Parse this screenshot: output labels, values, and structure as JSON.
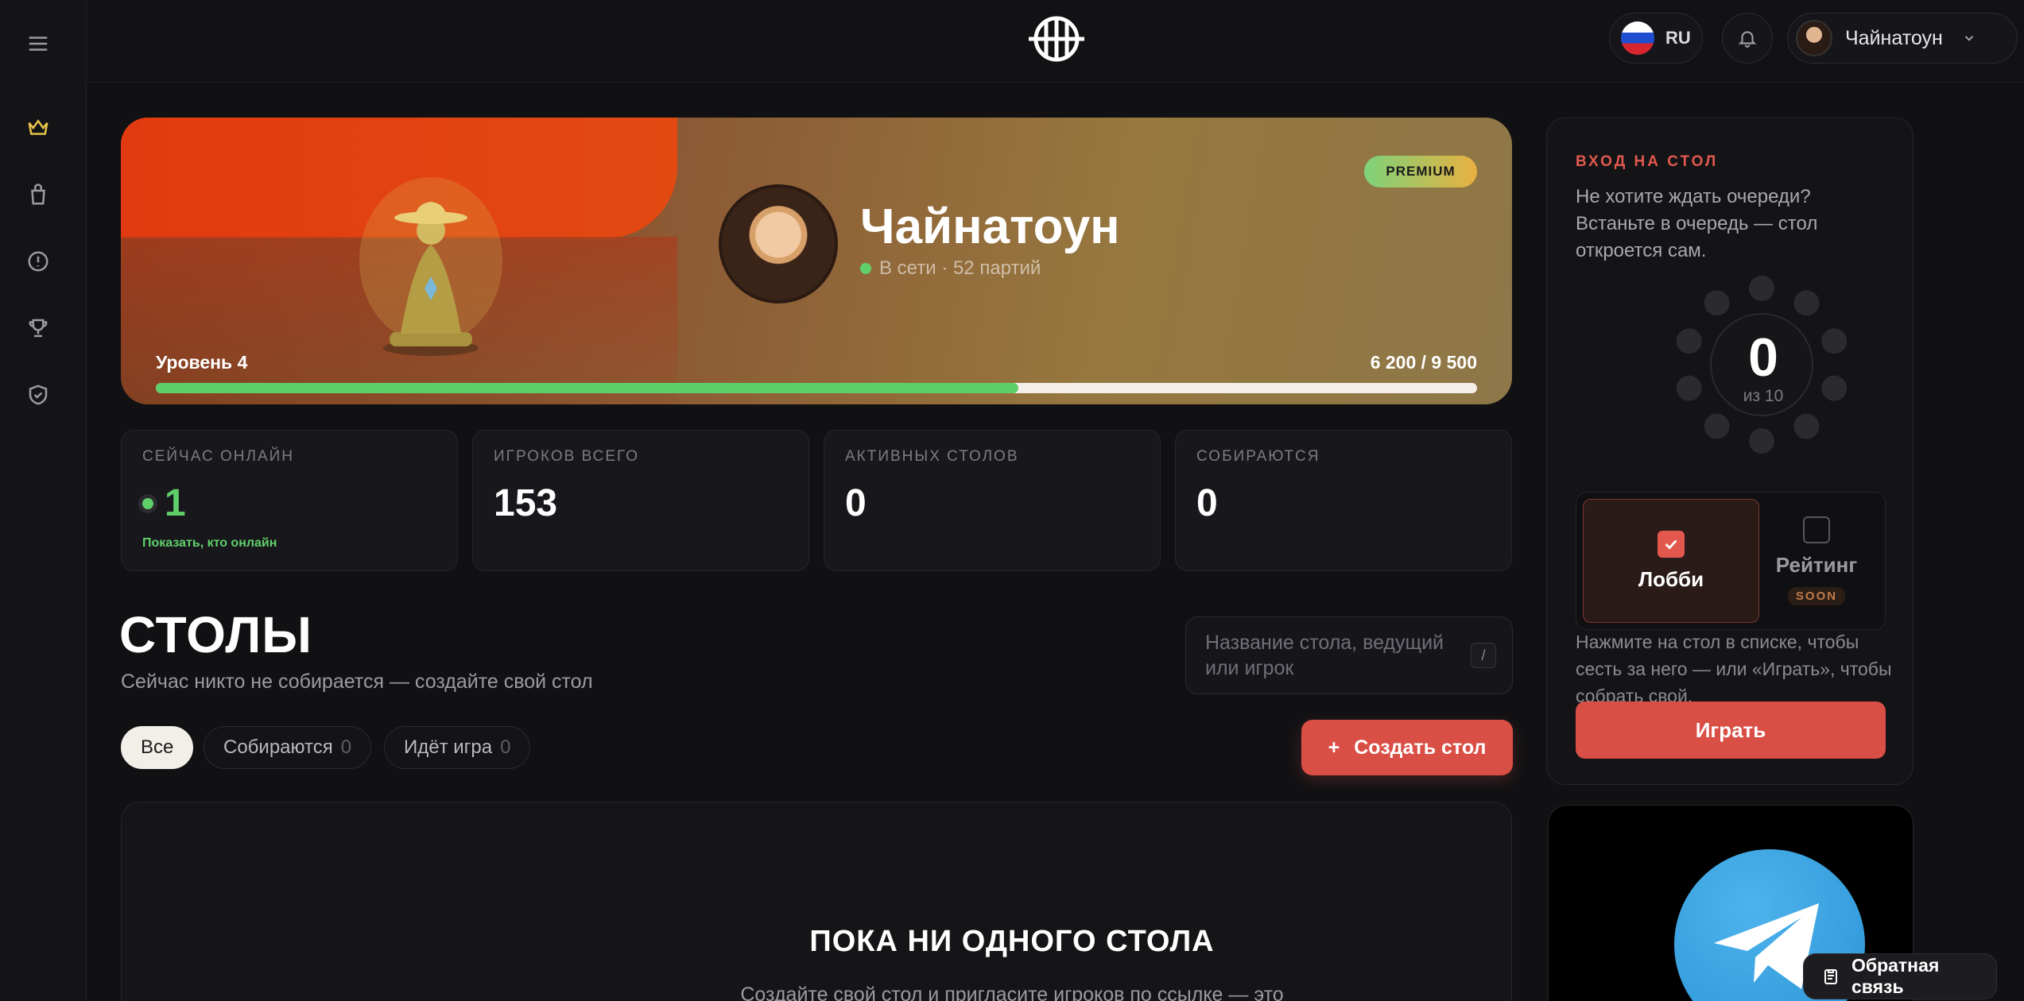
{
  "topbar": {
    "lang": "RU",
    "user_name": "Чайнатоун"
  },
  "hero": {
    "badge": "PREMIUM",
    "name": "Чайнатоун",
    "status": "В сети · 52 партий",
    "level": "Уровень 4",
    "xp": "6 200 / 9 500",
    "xp_progress": 0.653
  },
  "stats": [
    {
      "label": "СЕЙЧАС ОНЛАЙН",
      "value": "1",
      "link": "Показать, кто онлайн"
    },
    {
      "label": "ИГРОКОВ ВСЕГО",
      "value": "153"
    },
    {
      "label": "АКТИВНЫХ СТОЛОВ",
      "value": "0"
    },
    {
      "label": "СОБИРАЮТСЯ",
      "value": "0"
    }
  ],
  "tables": {
    "title": "СТОЛЫ",
    "subtitle": "Сейчас никто не собирается — создайте свой стол",
    "search_placeholder": "Название стола, ведущий или игрок",
    "search_shortcut": "/",
    "filters": [
      {
        "label": "Все",
        "count": ""
      },
      {
        "label": "Собираются",
        "count": "0"
      },
      {
        "label": "Идёт игра",
        "count": "0"
      }
    ],
    "create_label": "Создать стол",
    "empty_title": "ПОКА НИ ОДНОГО СТОЛА",
    "empty_sub": "Создайте свой стол и пригласите игроков по ссылке — это"
  },
  "join": {
    "label": "ВХОД НА СТОЛ",
    "text": "Не хотите ждать очереди? Встаньте в очередь — стол откроется сам.",
    "count": "0",
    "of": "из 10",
    "mode_lobby": "Лобби",
    "mode_rating": "Рейтинг",
    "soon": "SOON",
    "hint": "Нажмите на стол в списке, чтобы сесть за него — или «Играть», чтобы собрать свой.",
    "play": "Играть"
  },
  "feedback": "Обратная связь",
  "colors": {
    "accent": "#d94e45",
    "online": "#5fcf6a",
    "active_nav": "#e7c34a"
  }
}
